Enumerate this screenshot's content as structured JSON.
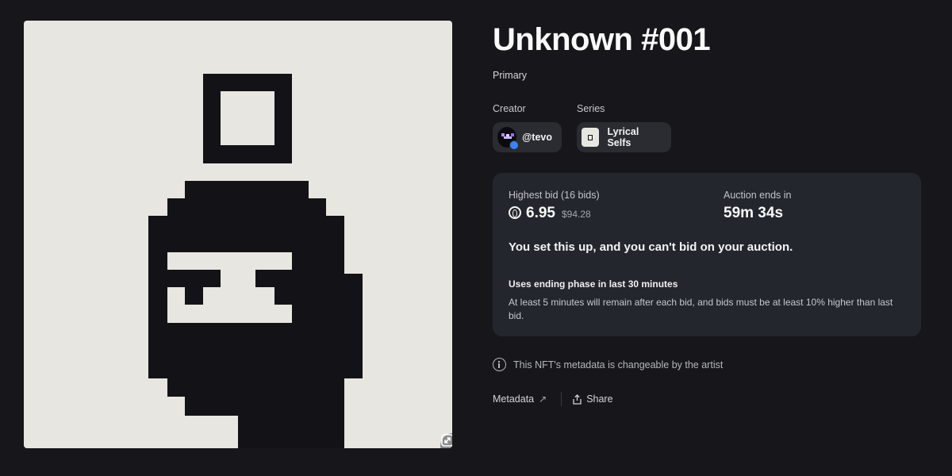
{
  "artwork": {
    "background": "#e7e6e0",
    "ink": "#131317",
    "expand_icon": "expand-icon"
  },
  "nft": {
    "title": "Unknown #001",
    "sale_type": "Primary"
  },
  "creator": {
    "label": "Creator",
    "handle": "@tevo",
    "verified": true
  },
  "series": {
    "label": "Series",
    "name": "Lyrical Selfs"
  },
  "auction": {
    "highest_bid_label": "Highest bid (16 bids)",
    "bid_amount": "6.95",
    "bid_usd": "$94.28",
    "ends_label": "Auction ends in",
    "time_left": "59m 34s",
    "owner_message": "You set this up, and you can't bid on your auction.",
    "phase_title": "Uses ending phase in last 30 minutes",
    "phase_description": "At least 5 minutes will remain after each bid, and bids must be at least 10% higher than last bid."
  },
  "notice": {
    "text": "This NFT's metadata is changeable by the artist",
    "icon": "info-icon"
  },
  "footer": {
    "metadata_label": "Metadata",
    "share_label": "Share"
  },
  "colors": {
    "page_bg": "#17171b",
    "card_bg": "#23262d",
    "chip_bg": "#2b2c31",
    "verified": "#3b82f6"
  }
}
